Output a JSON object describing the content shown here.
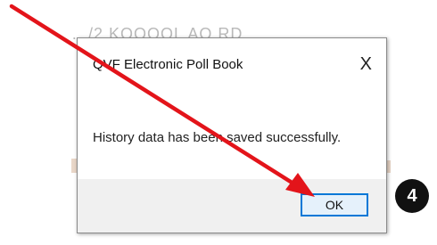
{
  "background": {
    "partial_text": "…/2 KOOOOL AO RD",
    "blot_color": "#e9d7c8"
  },
  "dialog": {
    "title": "QVF Electronic Poll Book",
    "close_glyph": "X",
    "message": "History data has been saved successfully.",
    "ok_label": "OK",
    "accent_color": "#0078d7"
  },
  "annotation": {
    "step_number": "4",
    "arrow_color": "#e3141a",
    "icon": "red-arrow-icon"
  }
}
